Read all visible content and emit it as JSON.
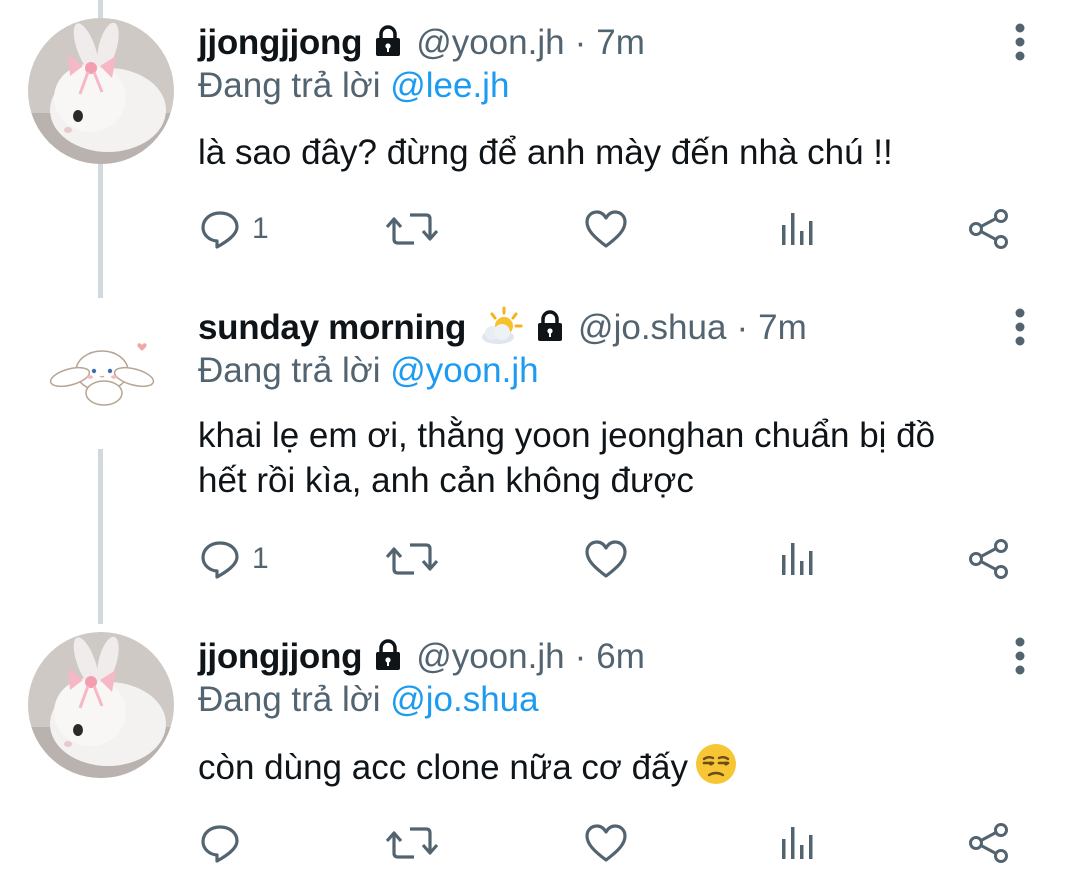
{
  "colors": {
    "text": "#0f1419",
    "secondary": "#536471",
    "link": "#1d9bf0",
    "thread_line": "#cfd9de",
    "icon": "#536471"
  },
  "tweets": [
    {
      "display_name": "jjongjjong",
      "handle": "@yoon.jh",
      "separator": "·",
      "time": "7m",
      "replying_prefix": "Đang trả lời",
      "replying_to": "@lee.jh",
      "text_lines": [
        "là sao đây? đừng để anh mày đến nhà chú !!"
      ],
      "reply_count": "1",
      "avatar": "bunny-with-pink-bow",
      "name_emoji": ""
    },
    {
      "display_name": "sunday morning",
      "handle": "@jo.shua",
      "separator": "·",
      "time": "7m",
      "replying_prefix": "Đang trả lời",
      "replying_to": "@yoon.jh",
      "text_lines": [
        "khai lẹ em ơi, thằng yoon jeonghan chuẩn bị đồ",
        "hết rồi kìa, anh cản không được"
      ],
      "reply_count": "1",
      "avatar": "cinnamoroll",
      "name_emoji": "sun-behind-cloud-icon"
    },
    {
      "display_name": "jjongjjong",
      "handle": "@yoon.jh",
      "separator": "·",
      "time": "6m",
      "replying_prefix": "Đang trả lời",
      "replying_to": "@jo.shua",
      "text_lines": [
        "còn dùng acc clone nữa cơ đấy"
      ],
      "text_emoji": "unamused-face-icon",
      "reply_count": "",
      "avatar": "bunny-with-pink-bow",
      "name_emoji": ""
    }
  ]
}
